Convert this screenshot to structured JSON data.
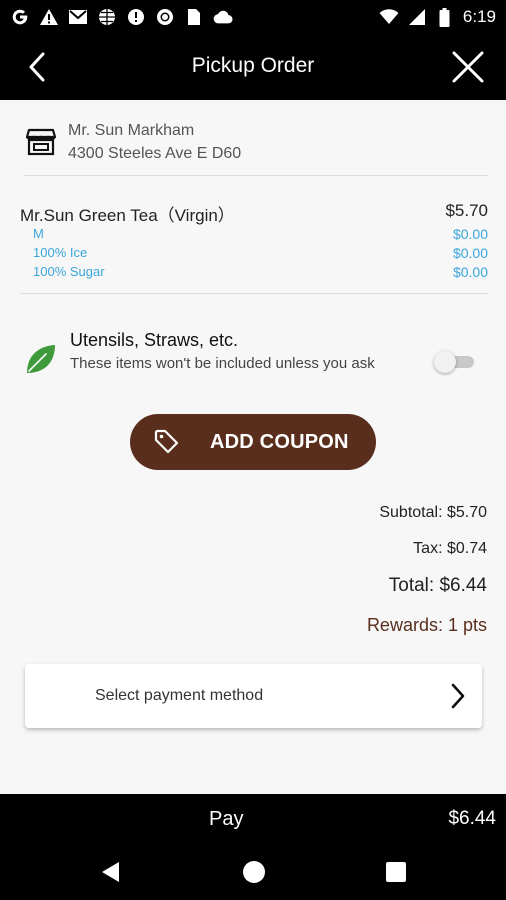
{
  "status_bar": {
    "time": "6:19",
    "icons": [
      "google-icon",
      "warning-icon",
      "gmail-icon",
      "globe-icon",
      "info-icon",
      "record-icon",
      "sim-icon",
      "cloud-icon",
      "wifi-icon",
      "signal-icon",
      "battery-icon"
    ]
  },
  "header": {
    "title": "Pickup Order"
  },
  "store": {
    "name": "Mr. Sun Markham",
    "address": "4300 Steeles Ave E D60"
  },
  "order": {
    "item_name": "Mr.Sun Green Tea（Virgin）",
    "item_price": "$5.70",
    "options": [
      {
        "label": "M",
        "price": "$0.00"
      },
      {
        "label": "100% Ice",
        "price": "$0.00"
      },
      {
        "label": "100% Sugar",
        "price": "$0.00"
      }
    ]
  },
  "utensils": {
    "title": "Utensils, Straws, etc.",
    "subtitle": "These items won't be included unless you ask",
    "toggle_on": false
  },
  "coupon": {
    "label": "ADD COUPON"
  },
  "totals": {
    "subtotal": "Subtotal: $5.70",
    "tax": "Tax: $0.74",
    "total": "Total: $6.44",
    "rewards": "Rewards: 1 pts"
  },
  "payment": {
    "label": "Select payment method"
  },
  "pay_bar": {
    "label": "Pay",
    "amount": "$6.44"
  },
  "colors": {
    "accent_brown": "#5a2e1d",
    "option_blue": "#3aa6dc",
    "leaf_green": "#3e9a3a"
  }
}
